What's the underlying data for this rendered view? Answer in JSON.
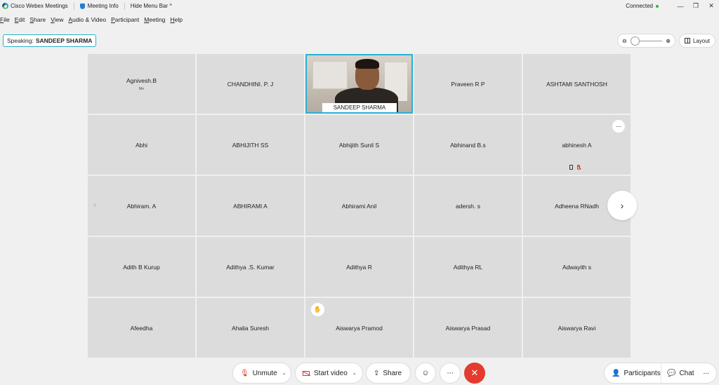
{
  "titlebar": {
    "app_name": "Cisco Webex Meetings",
    "meeting_info": "Meeting Info",
    "hide_menu": "Hide Menu Bar ^",
    "status": "Connected",
    "min": "—",
    "restore": "❐",
    "close": "✕"
  },
  "menu": [
    "File",
    "Edit",
    "Share",
    "View",
    "Audio & Video",
    "Participant",
    "Meeting",
    "Help"
  ],
  "speaking": {
    "prefix": "Speaking:",
    "name": "SANDEEP SHARMA"
  },
  "layout_label": "Layout",
  "zoom": {
    "minus": "⊖",
    "plus": "⊕",
    "level": 0
  },
  "tiles": [
    {
      "name": "Agnivesh.B",
      "sub": "Me"
    },
    {
      "name": "CHANDHINI. P. J"
    },
    {
      "name": "SANDEEP SHARMA",
      "active": true
    },
    {
      "name": "Praveen R P"
    },
    {
      "name": "ASHTAMI SANTHOSH"
    },
    {
      "name": "Abhi"
    },
    {
      "name": "ABHIJITH SS"
    },
    {
      "name": "Abhijith Sunil S"
    },
    {
      "name": "Abhinand B.s"
    },
    {
      "name": "abhinesh A"
    },
    {
      "name": "Abhiram. A"
    },
    {
      "name": "ABHIRAMI A"
    },
    {
      "name": "Abhirami Anil"
    },
    {
      "name": "adersh. s"
    },
    {
      "name": "Adheena RNadh"
    },
    {
      "name": "Adith B Kurup"
    },
    {
      "name": "Adithya .S. Kumar"
    },
    {
      "name": "Adithya R"
    },
    {
      "name": "Adithya RL"
    },
    {
      "name": "Adwayith s"
    },
    {
      "name": "Afeedha"
    },
    {
      "name": "Ahalia Suresh"
    },
    {
      "name": "Aiswarya Pramod"
    },
    {
      "name": "Aiswarya Prasad"
    },
    {
      "name": "Aiswarya Ravi"
    }
  ],
  "nav": {
    "prev": "‹",
    "next": "›"
  },
  "controls": {
    "unmute": "Unmute",
    "start_video": "Start video",
    "share": "Share",
    "participants": "Participants",
    "chat": "Chat",
    "more": "···",
    "leave": "✕",
    "caret": "⌄"
  },
  "colors": {
    "accent": "#27b1d8",
    "leave": "#e33b2e",
    "muted": "#d93025",
    "connected": "#2ab54a"
  }
}
